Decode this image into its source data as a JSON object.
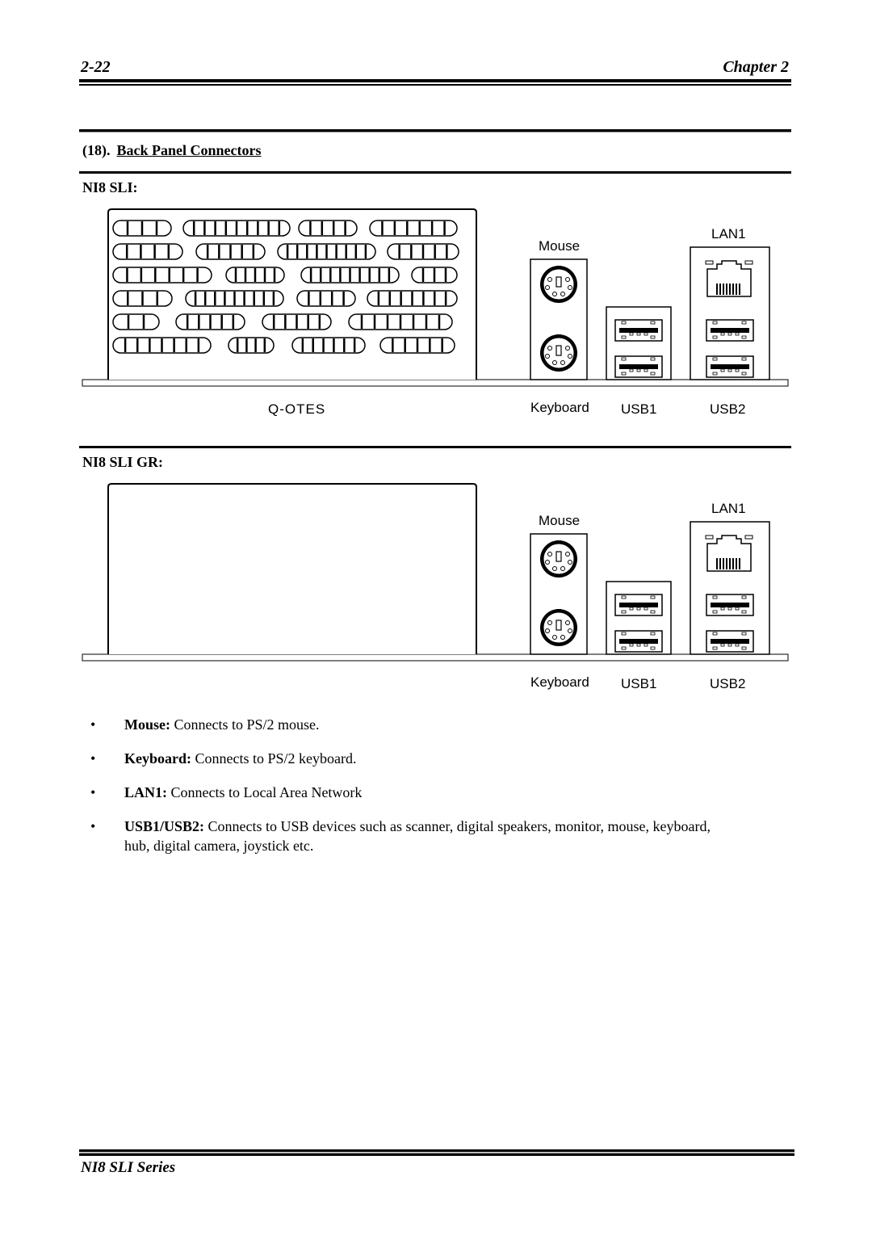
{
  "header": {
    "page_number": "2-22",
    "chapter": "Chapter 2"
  },
  "section": {
    "number": "(18).",
    "title": "Back Panel Connectors"
  },
  "diagrams": [
    {
      "model": "NI8 SLI:",
      "io_shield_label": "Q-OTES",
      "labels": {
        "mouse": "Mouse",
        "keyboard": "Keyboard",
        "usb1": "USB1",
        "lan1": "LAN1",
        "usb2": "USB2"
      }
    },
    {
      "model": "NI8 SLI GR:",
      "io_shield_label": "",
      "labels": {
        "mouse": "Mouse",
        "keyboard": "Keyboard",
        "usb1": "USB1",
        "lan1": "LAN1",
        "usb2": "USB2"
      }
    }
  ],
  "bullets": [
    {
      "term": "Mouse:",
      "text": " Connects to PS/2 mouse."
    },
    {
      "term": "Keyboard:",
      "text": " Connects to PS/2 keyboard."
    },
    {
      "term": "LAN1:",
      "text": " Connects to Local Area Network"
    },
    {
      "term": "USB1/USB2:",
      "text": " Connects to USB devices such as scanner, digital speakers, monitor, mouse, keyboard, hub, digital camera, joystick etc."
    }
  ],
  "footer": {
    "series": "NI8 SLI Series"
  },
  "bullet_glyph": "•"
}
